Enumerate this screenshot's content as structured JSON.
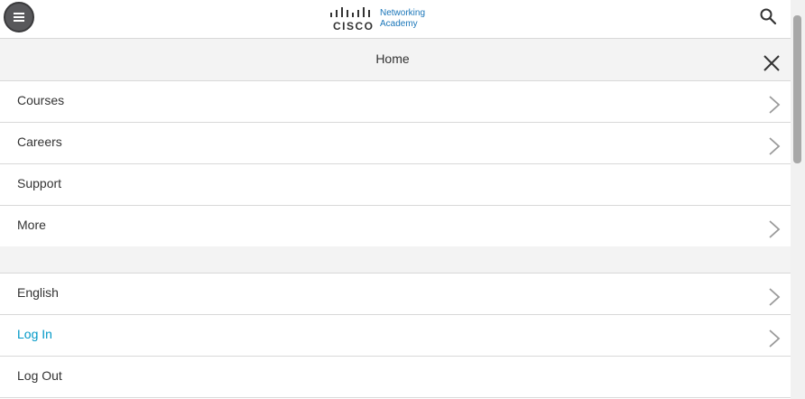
{
  "header": {
    "logo_brand": "CISCO",
    "logo_line1": "Networking",
    "logo_line2": "Academy",
    "menu_icon": "hamburger-icon",
    "search_icon": "search-icon"
  },
  "panel": {
    "title": "Home",
    "close_icon": "close-icon"
  },
  "menu_items": [
    {
      "label": "Courses",
      "has_chevron": true
    },
    {
      "label": "Careers",
      "has_chevron": true
    },
    {
      "label": "Support",
      "has_chevron": false
    },
    {
      "label": "More",
      "has_chevron": true
    }
  ],
  "account_items": [
    {
      "label": "English",
      "has_chevron": true
    },
    {
      "label": "Log In",
      "has_chevron": true,
      "is_link": true
    },
    {
      "label": "Log Out",
      "has_chevron": false
    }
  ],
  "colors": {
    "link": "#0098c7",
    "brand": "#1a76b9",
    "panel_bg": "#f3f3f3"
  }
}
